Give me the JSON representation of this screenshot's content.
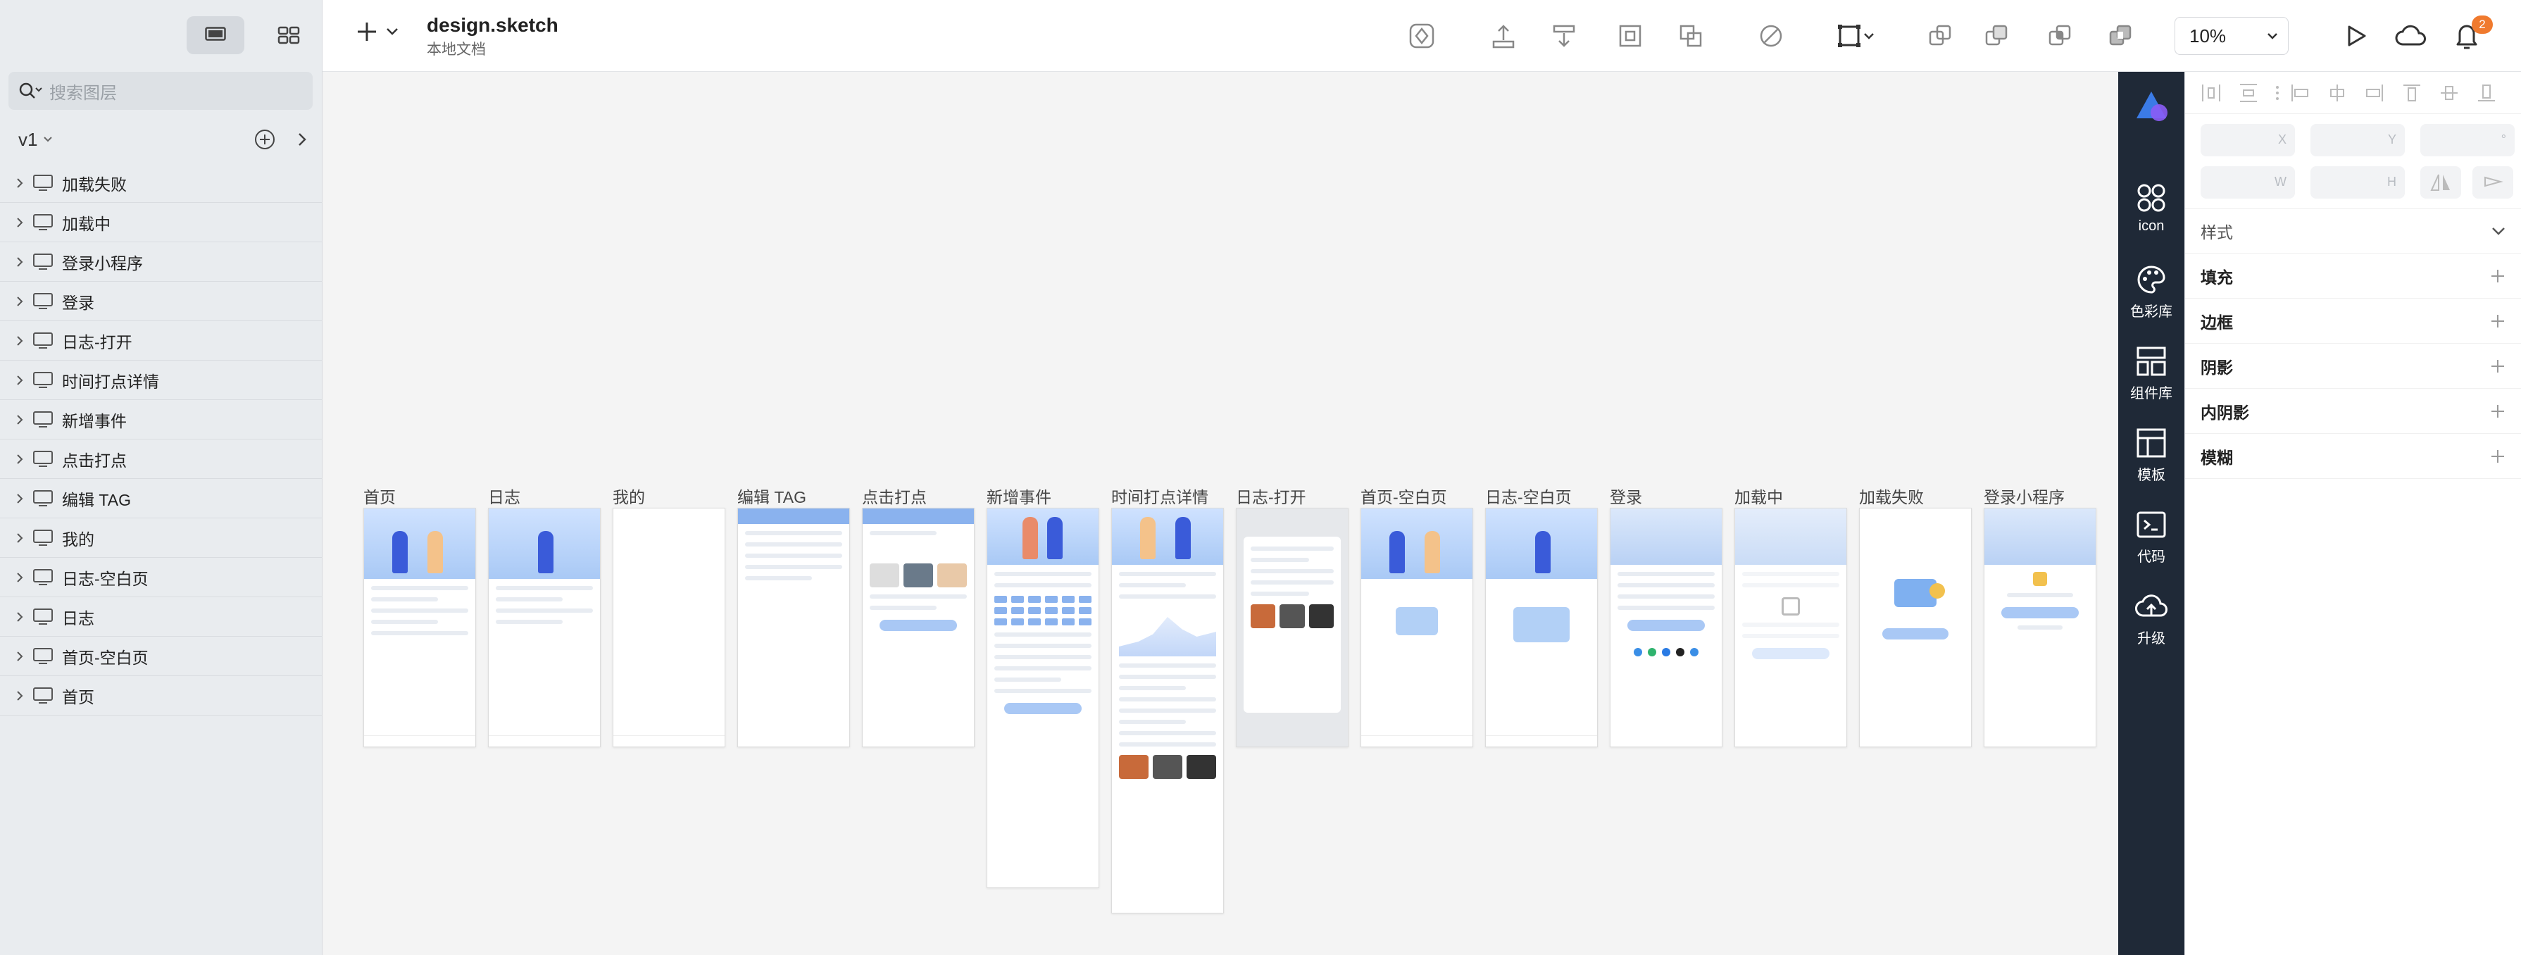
{
  "sidebar": {
    "search_placeholder": "搜索图层",
    "version": "v1",
    "layers": [
      {
        "name": "加载失败"
      },
      {
        "name": "加载中"
      },
      {
        "name": "登录小程序"
      },
      {
        "name": "登录"
      },
      {
        "name": "日志-打开"
      },
      {
        "name": "时间打点详情"
      },
      {
        "name": "新增事件"
      },
      {
        "name": "点击打点"
      },
      {
        "name": "编辑 TAG"
      },
      {
        "name": "我的"
      },
      {
        "name": "日志-空白页"
      },
      {
        "name": "日志"
      },
      {
        "name": "首页-空白页"
      },
      {
        "name": "首页"
      }
    ]
  },
  "topbar": {
    "doc_title": "design.sketch",
    "doc_subtitle": "本地文档",
    "zoom": "10%",
    "notification_count": "2"
  },
  "canvas": {
    "artboards": [
      {
        "name": "首页"
      },
      {
        "name": "日志"
      },
      {
        "name": "我的"
      },
      {
        "name": "编辑 TAG"
      },
      {
        "name": "点击打点"
      },
      {
        "name": "新增事件"
      },
      {
        "name": "时间打点详情"
      },
      {
        "name": "日志-打开"
      },
      {
        "name": "首页-空白页"
      },
      {
        "name": "日志-空白页"
      },
      {
        "name": "登录"
      },
      {
        "name": "加载中"
      },
      {
        "name": "加载失败"
      },
      {
        "name": "登录小程序"
      }
    ]
  },
  "tool_strip": {
    "tools": [
      {
        "label": "icon",
        "icon": "icon-grid-icon"
      },
      {
        "label": "色彩库",
        "icon": "palette-icon"
      },
      {
        "label": "组件库",
        "icon": "components-icon"
      },
      {
        "label": "模板",
        "icon": "template-icon"
      },
      {
        "label": "代码",
        "icon": "code-icon"
      },
      {
        "label": "升级",
        "icon": "upload-cloud-icon"
      }
    ]
  },
  "inspector": {
    "fields": {
      "x": "X",
      "y": "Y",
      "rotation": "°",
      "w": "W",
      "h": "H"
    },
    "style_section": "样式",
    "properties": [
      {
        "label": "填充"
      },
      {
        "label": "边框"
      },
      {
        "label": "阴影"
      },
      {
        "label": "内阴影"
      },
      {
        "label": "模糊"
      }
    ]
  },
  "colors": {
    "accent": "#3b82f6",
    "strip_bg": "#1f2937",
    "badge": "#f07a2e"
  }
}
